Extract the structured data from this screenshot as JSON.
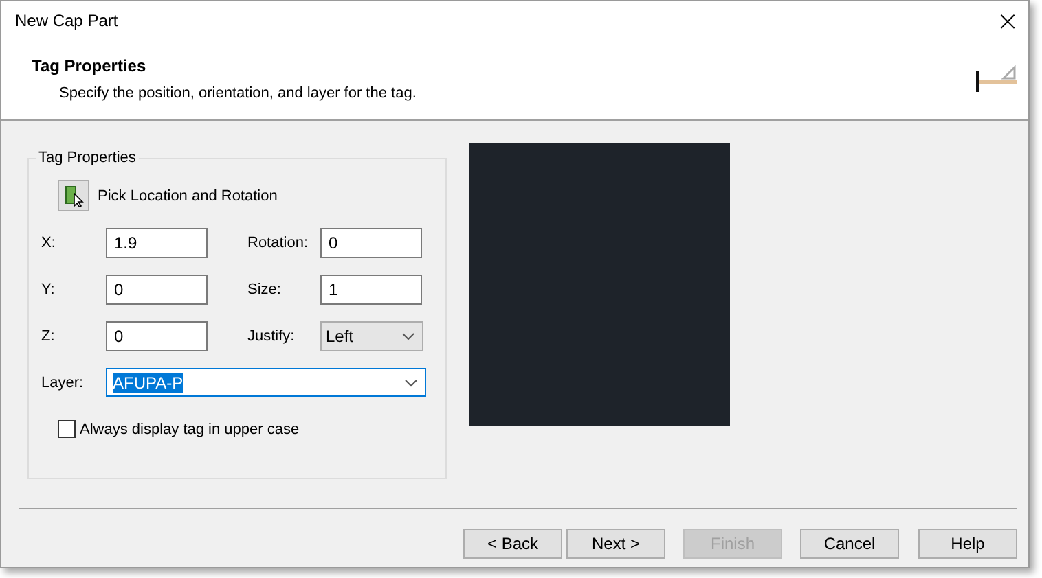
{
  "window": {
    "title": "New Cap Part",
    "close": "×"
  },
  "header": {
    "title": "Tag Properties",
    "subtitle": "Specify the position, orientation, and layer for the tag."
  },
  "group": {
    "title": "Tag Properties",
    "pick_button": "Pick Location and Rotation",
    "fields": [
      {
        "label": "X:",
        "value": "1.9",
        "kind": "text"
      },
      {
        "label": "Rotation:",
        "value": "0",
        "kind": "text"
      },
      {
        "label": "Y:",
        "value": "0",
        "kind": "text"
      },
      {
        "label": "Size:",
        "value": "1",
        "kind": "text"
      },
      {
        "label": "Z:",
        "value": "0",
        "kind": "text"
      },
      {
        "label": "Justify:",
        "value": "Left",
        "kind": "dropdown"
      }
    ],
    "layer": {
      "label": "Layer:",
      "value": "AFUPA-P",
      "selected": true
    },
    "uppercase": {
      "label": "Always display tag in upper case",
      "checked": false
    }
  },
  "buttons": [
    {
      "label": "< Back",
      "disabled": false
    },
    {
      "label": "Next >",
      "disabled": false
    },
    {
      "label": "Finish",
      "disabled": true
    },
    {
      "label": "Cancel",
      "disabled": false
    },
    {
      "label": "Help",
      "disabled": false
    }
  ]
}
